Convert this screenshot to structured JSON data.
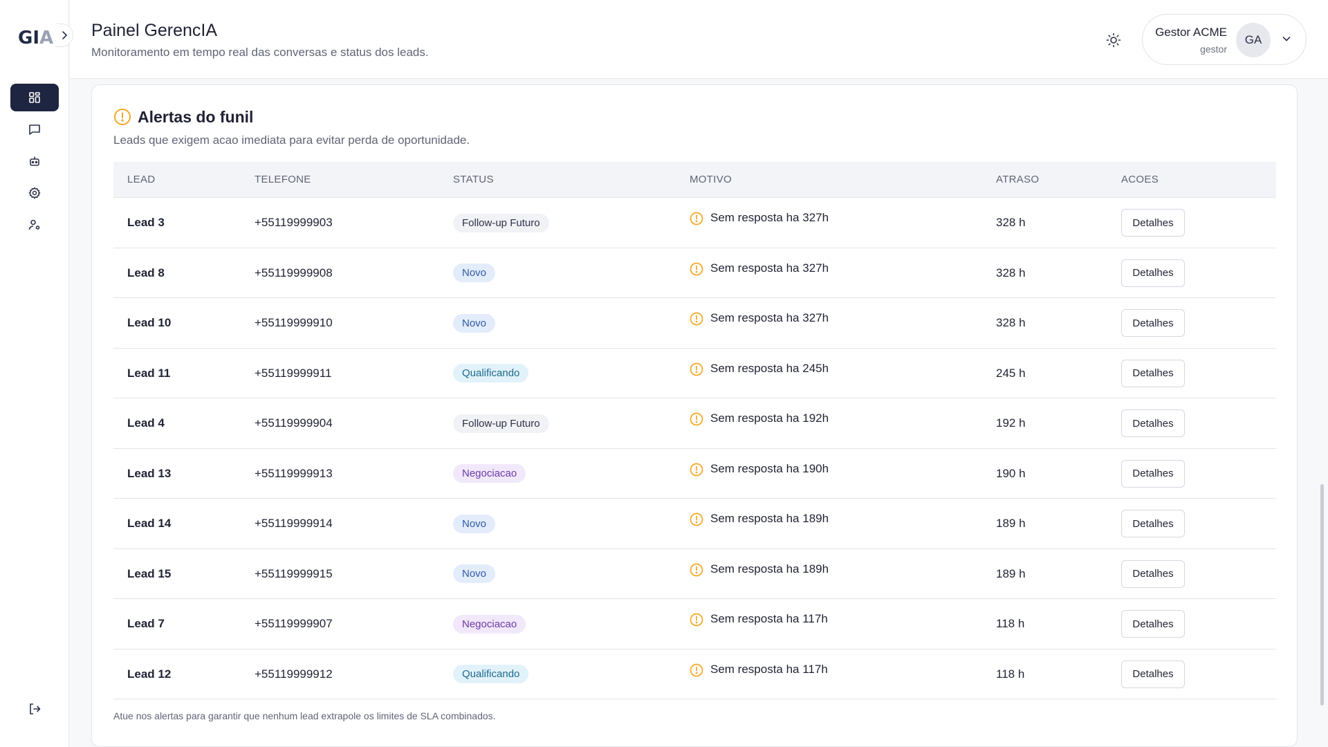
{
  "app": {
    "logo": "GIA",
    "colors": {
      "primary": "#1e2540",
      "warning": "#f5a623",
      "border": "#e2e4ea"
    }
  },
  "sidebar": {
    "items": [
      {
        "name": "dashboard",
        "icon": "grid-icon",
        "active": true
      },
      {
        "name": "conversations",
        "icon": "message-icon",
        "active": false
      },
      {
        "name": "bot",
        "icon": "bot-icon",
        "active": false
      },
      {
        "name": "settings",
        "icon": "gear-icon",
        "active": false
      },
      {
        "name": "users",
        "icon": "user-settings-icon",
        "active": false
      }
    ],
    "logout_icon": "logout-icon"
  },
  "header": {
    "title": "Painel GerencIA",
    "subtitle": "Monitoramento em tempo real das conversas e status dos leads.",
    "user": {
      "name": "Gestor ACME",
      "role": "gestor",
      "initials": "GA"
    }
  },
  "alerts": {
    "title": "Alertas do funil",
    "description": "Leads que exigem acao imediata para evitar perda de oportunidade.",
    "columns": [
      "LEAD",
      "TELEFONE",
      "STATUS",
      "MOTIVO",
      "ATRASO",
      "ACOES"
    ],
    "rows": [
      {
        "lead": "Lead 3",
        "phone": "+55119999903",
        "status": "Follow-up Futuro",
        "status_type": "followup",
        "reason": "Sem resposta ha 327h",
        "delay": "328 h",
        "action": "Detalhes"
      },
      {
        "lead": "Lead 8",
        "phone": "+55119999908",
        "status": "Novo",
        "status_type": "novo",
        "reason": "Sem resposta ha 327h",
        "delay": "328 h",
        "action": "Detalhes"
      },
      {
        "lead": "Lead 10",
        "phone": "+55119999910",
        "status": "Novo",
        "status_type": "novo",
        "reason": "Sem resposta ha 327h",
        "delay": "328 h",
        "action": "Detalhes"
      },
      {
        "lead": "Lead 11",
        "phone": "+55119999911",
        "status": "Qualificando",
        "status_type": "qualificando",
        "reason": "Sem resposta ha 245h",
        "delay": "245 h",
        "action": "Detalhes"
      },
      {
        "lead": "Lead 4",
        "phone": "+55119999904",
        "status": "Follow-up Futuro",
        "status_type": "followup",
        "reason": "Sem resposta ha 192h",
        "delay": "192 h",
        "action": "Detalhes"
      },
      {
        "lead": "Lead 13",
        "phone": "+55119999913",
        "status": "Negociacao",
        "status_type": "negociacao",
        "reason": "Sem resposta ha 190h",
        "delay": "190 h",
        "action": "Detalhes"
      },
      {
        "lead": "Lead 14",
        "phone": "+55119999914",
        "status": "Novo",
        "status_type": "novo",
        "reason": "Sem resposta ha 189h",
        "delay": "189 h",
        "action": "Detalhes"
      },
      {
        "lead": "Lead 15",
        "phone": "+55119999915",
        "status": "Novo",
        "status_type": "novo",
        "reason": "Sem resposta ha 189h",
        "delay": "189 h",
        "action": "Detalhes"
      },
      {
        "lead": "Lead 7",
        "phone": "+55119999907",
        "status": "Negociacao",
        "status_type": "negociacao",
        "reason": "Sem resposta ha 117h",
        "delay": "118 h",
        "action": "Detalhes"
      },
      {
        "lead": "Lead 12",
        "phone": "+55119999912",
        "status": "Qualificando",
        "status_type": "qualificando",
        "reason": "Sem resposta ha 117h",
        "delay": "118 h",
        "action": "Detalhes"
      }
    ],
    "footer": "Atue nos alertas para garantir que nenhum lead extrapole os limites de SLA combinados."
  }
}
